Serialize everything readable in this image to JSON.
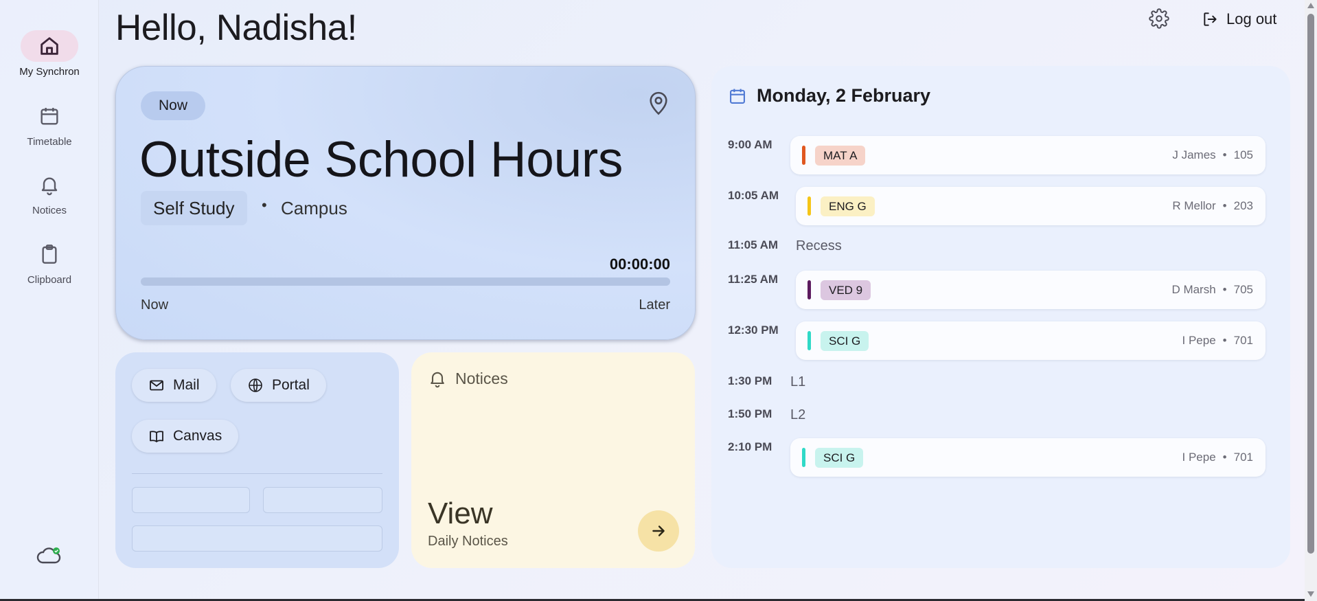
{
  "header": {
    "greeting": "Hello, Nadisha!",
    "logout_label": "Log out"
  },
  "sidebar": {
    "items": [
      {
        "label": "My Synchron",
        "icon": "home-icon",
        "active": true
      },
      {
        "label": "Timetable",
        "icon": "calendar-icon",
        "active": false
      },
      {
        "label": "Notices",
        "icon": "bell-icon",
        "active": false
      },
      {
        "label": "Clipboard",
        "icon": "clipboard-icon",
        "active": false
      }
    ],
    "sync_icon": "cloud-sync-icon"
  },
  "now_card": {
    "chip": "Now",
    "title": "Outside School Hours",
    "subject": "Self Study",
    "location": "Campus",
    "timer": "00:00:00",
    "progress": 0,
    "start_label": "Now",
    "end_label": "Later"
  },
  "links": {
    "mail": "Mail",
    "portal": "Portal",
    "canvas": "Canvas"
  },
  "notices_card": {
    "title": "Notices",
    "view": "View",
    "subtitle": "Daily Notices"
  },
  "schedule": {
    "date": "Monday, 2 February",
    "rows": [
      {
        "time": "9:00 AM",
        "code": "MAT A",
        "teacher": "J James",
        "room": "105",
        "color": "#e0571f",
        "chip": "#f6d3c9"
      },
      {
        "time": "10:05 AM",
        "code": "ENG G",
        "teacher": "R Mellor",
        "room": "203",
        "color": "#f5c518",
        "chip": "#fbf0c4"
      },
      {
        "time": "11:05 AM",
        "break": "Recess"
      },
      {
        "time": "11:25 AM",
        "code": "VED 9",
        "teacher": "D Marsh",
        "room": "705",
        "color": "#5b1a5e",
        "chip": "#dcc7e0"
      },
      {
        "time": "12:30 PM",
        "code": "SCI G",
        "teacher": "I Pepe",
        "room": "701",
        "color": "#2fd9c7",
        "chip": "#c8f3ee"
      },
      {
        "time": "1:30 PM",
        "break": "L1"
      },
      {
        "time": "1:50 PM",
        "break": "L2"
      },
      {
        "time": "2:10 PM",
        "code": "SCI G",
        "teacher": "I Pepe",
        "room": "701",
        "color": "#2fd9c7",
        "chip": "#c8f3ee"
      }
    ]
  },
  "separator": "•"
}
